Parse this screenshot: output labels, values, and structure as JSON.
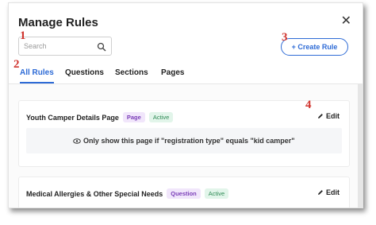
{
  "modal": {
    "title": "Manage Rules"
  },
  "search": {
    "placeholder": "Search"
  },
  "create_button": {
    "label": "+ Create Rule"
  },
  "tabs": [
    {
      "label": "All Rules",
      "active": true
    },
    {
      "label": "Questions"
    },
    {
      "label": "Sections"
    },
    {
      "label": "Pages"
    }
  ],
  "annotations": [
    "1",
    "2",
    "3",
    "4"
  ],
  "rules": [
    {
      "title": "Youth Camper Details Page",
      "type": "Page",
      "status": "Active",
      "edit_label": "Edit",
      "condition": "Only show this page if \"registration type\" equals \"kid camper\""
    },
    {
      "title": "Medical Allergies & Other Special Needs",
      "type": "Question",
      "status": "Active",
      "edit_label": "Edit"
    }
  ],
  "colors": {
    "accent": "#2e6bd6",
    "annotation": "#d0332d",
    "type_pill": "#f1e6fb",
    "status_pill": "#e2f5ea"
  },
  "icons": {
    "close": "close-icon",
    "search": "search-icon",
    "edit": "pencil-icon",
    "eye": "eye-icon"
  }
}
